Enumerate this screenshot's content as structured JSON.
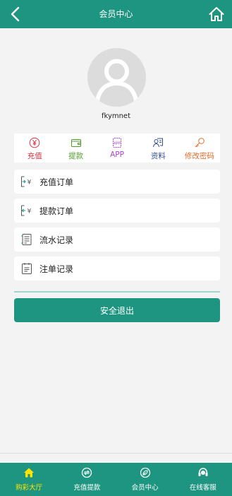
{
  "header": {
    "title": "会员中心",
    "back_icon": "back-arrow-icon",
    "home_icon": "home-icon"
  },
  "profile": {
    "username": "fkymnet",
    "avatar_icon": "user-avatar-icon"
  },
  "quick_actions": [
    {
      "label": "充值",
      "icon": "yuan-coin-icon",
      "color": "#e0303e"
    },
    {
      "label": "提款",
      "icon": "wallet-icon",
      "color": "#4f9d2a"
    },
    {
      "label": "APP",
      "icon": "app-icon",
      "color": "#b03fce"
    },
    {
      "label": "资料",
      "icon": "profile-card-icon",
      "color": "#2f4f8f"
    },
    {
      "label": "修改密码",
      "icon": "key-icon",
      "color": "#e06b2a"
    }
  ],
  "menu": [
    {
      "label": "充值订单",
      "icon": "deposit-order-icon"
    },
    {
      "label": "提款订单",
      "icon": "withdraw-order-icon"
    },
    {
      "label": "流水记录",
      "icon": "transaction-record-icon"
    },
    {
      "label": "注单记录",
      "icon": "bet-record-icon"
    }
  ],
  "logout": {
    "label": "安全退出"
  },
  "tabbar": [
    {
      "label": "购彩大厅",
      "icon": "lobby-home-icon",
      "active": true
    },
    {
      "label": "充值提款",
      "icon": "exchange-icon",
      "active": false
    },
    {
      "label": "会员中心",
      "icon": "member-icon",
      "active": false
    },
    {
      "label": "在线客服",
      "icon": "customer-service-icon",
      "active": false
    }
  ],
  "colors": {
    "primary": "#1e9580",
    "active_tab": "#ffe400",
    "background": "#f3f3f3"
  }
}
